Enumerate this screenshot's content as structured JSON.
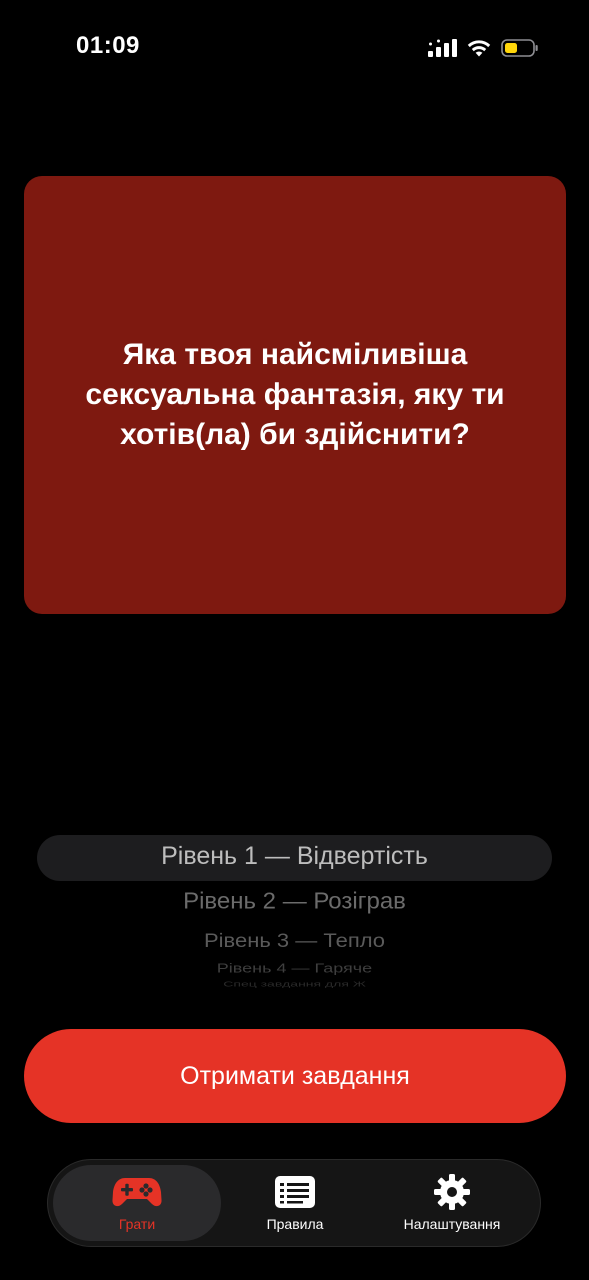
{
  "status_bar": {
    "time": "01:09",
    "battery_color": "#ffd60a"
  },
  "question": {
    "text": "Яка твоя найсміливіша сексуальна фантазія, яку ти хотів(ла) би здійснити?"
  },
  "level_picker": {
    "selected_index": 0,
    "levels": [
      "Рівень 1 — Відвертість",
      "Рівень 2 — Розіграв",
      "Рівень 3 — Тепло",
      "Рівень 4 — Гаряче",
      "Спец завдання для Ж"
    ]
  },
  "action": {
    "get_task_label": "Отримати завдання"
  },
  "tab_bar": {
    "tabs": [
      {
        "label": "Грати",
        "icon": "gamepad-icon",
        "active": true
      },
      {
        "label": "Правила",
        "icon": "list-icon",
        "active": false
      },
      {
        "label": "Налаштування",
        "icon": "gear-icon",
        "active": false
      }
    ]
  },
  "colors": {
    "background": "#000000",
    "card": "#7e1910",
    "accent": "#e53326",
    "picker_highlight": "#1d1d1f"
  }
}
